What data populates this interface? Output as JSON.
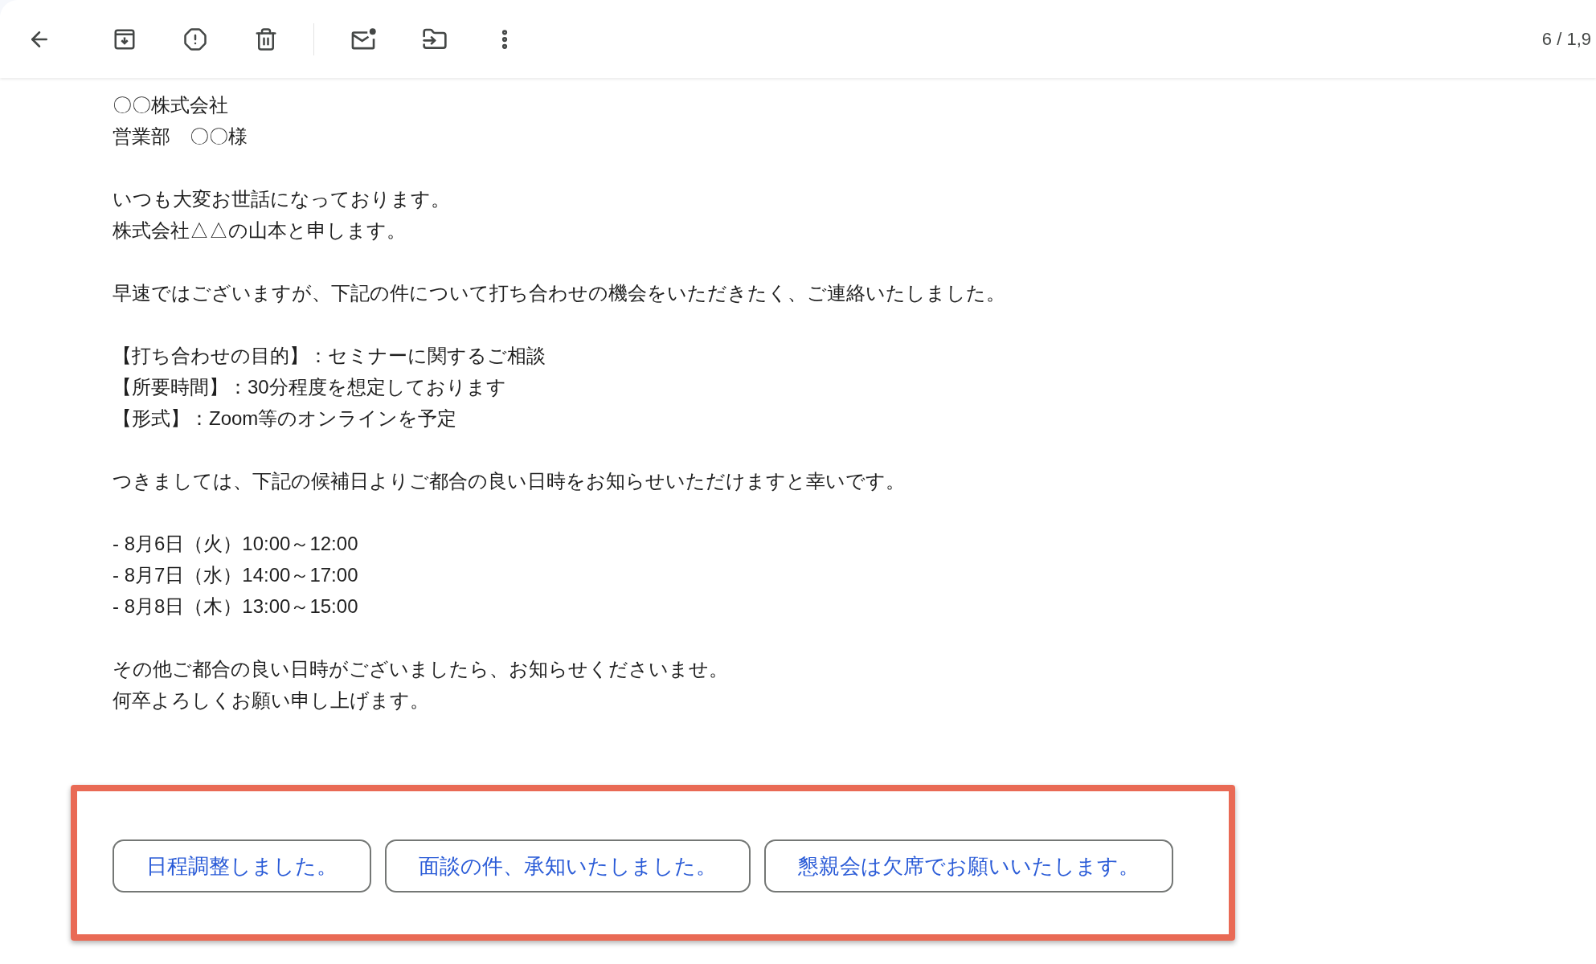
{
  "toolbar": {
    "counter": "6 / 1,9"
  },
  "body": [
    [
      "〇〇株式会社",
      "営業部　〇〇様"
    ],
    [
      "いつも大変お世話になっております。",
      "株式会社△△の山本と申します。"
    ],
    [
      "早速ではございますが、下記の件について打ち合わせの機会をいただきたく、ご連絡いたしました。"
    ],
    [
      "【打ち合わせの目的】：セミナーに関するご相談",
      "【所要時間】：30分程度を想定しております",
      "【形式】：Zoom等のオンラインを予定"
    ],
    [
      "つきましては、下記の候補日よりご都合の良い日時をお知らせいただけますと幸いです。"
    ],
    [
      "- 8月6日（火）10:00～12:00",
      "- 8月7日（水）14:00～17:00",
      "- 8月8日（木）13:00～15:00"
    ],
    [
      "その他ご都合の良い日時がございましたら、お知らせくださいませ。",
      "何卒よろしくお願い申し上げます。"
    ]
  ],
  "smart_replies": [
    "日程調整しました。",
    "面談の件、承知いたしました。",
    "懇親会は欠席でお願いいたします。"
  ]
}
